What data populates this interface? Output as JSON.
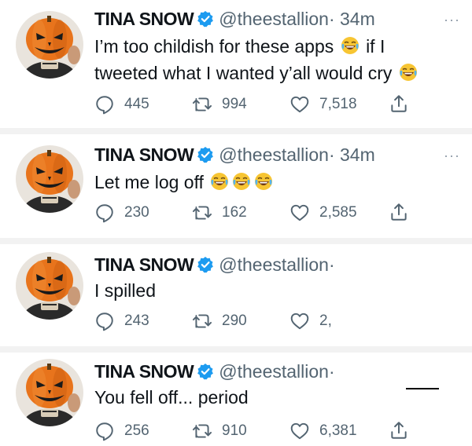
{
  "tweets": [
    {
      "name": "TINA SNOW",
      "handle": "@theestallion",
      "time": "· 34m",
      "line1": "I’m too childish for these apps",
      "line1b": "if I",
      "line2": "tweeted what I wanted y’all would cry",
      "replies": "445",
      "retweets": "994",
      "likes": "7,518",
      "more": "···"
    },
    {
      "name": "TINA SNOW",
      "handle": "@theestallion",
      "time": "· 34m",
      "line1": "Let me log off",
      "replies": "230",
      "retweets": "162",
      "likes": "2,585",
      "more": "···"
    },
    {
      "name": "TINA SNOW",
      "handle": "@theestallion",
      "time": "·",
      "line1": "I spilled",
      "replies": "243",
      "retweets": "290",
      "likes": "2,"
    },
    {
      "name": "TINA SNOW",
      "handle": "@theestallion",
      "time": "·",
      "line1": "You fell off... period",
      "replies": "256",
      "retweets": "910",
      "likes": "6,381"
    }
  ],
  "colors": {
    "verified": "#1d9bf0",
    "muted": "#536471",
    "pumpkin": "#e8741c",
    "divider": "#f2f2f2"
  },
  "icons": [
    "verified-badge-icon",
    "reply-icon",
    "retweet-icon",
    "like-icon",
    "share-icon",
    "more-icon",
    "laughing-emoji-icon"
  ]
}
